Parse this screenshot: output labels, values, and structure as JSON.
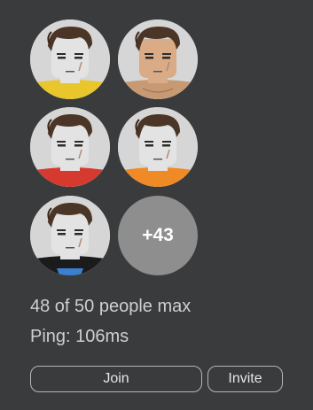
{
  "players": [
    {
      "shirt_color": "#e8c62c",
      "skin_color": "#e3e3e3",
      "name": "player-1"
    },
    {
      "shirt_color": "#c79a74",
      "skin_color": "#d9ab86",
      "name": "player-2"
    },
    {
      "shirt_color": "#d63a2e",
      "skin_color": "#e3e3e3",
      "name": "player-3"
    },
    {
      "shirt_color": "#f08a24",
      "skin_color": "#e3e3e3",
      "name": "player-4"
    },
    {
      "shirt_color": "#1b1b1b",
      "skin_color": "#e3e3e3",
      "name": "player-5",
      "accent_color": "#3a7fd0"
    }
  ],
  "more_count_label": "+43",
  "capacity_text": "48 of 50 people max",
  "ping_text": "Ping: 106ms",
  "buttons": {
    "join_label": "Join",
    "invite_label": "Invite"
  },
  "colors": {
    "background": "#393b3d",
    "text": "#cfcfd0",
    "button_border": "#b6b6b8",
    "more_badge": "#8e8e8e"
  }
}
